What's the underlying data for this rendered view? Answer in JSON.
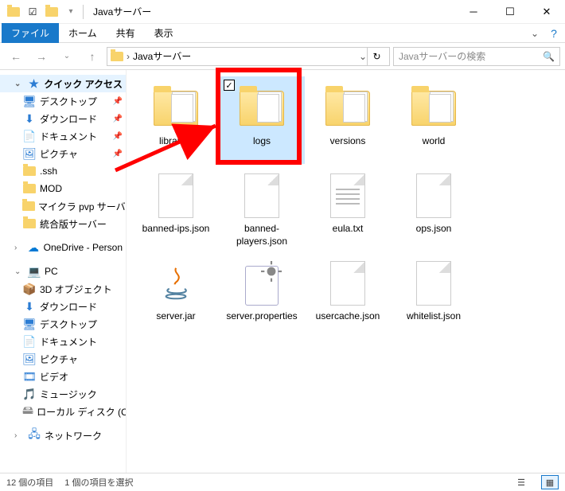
{
  "window": {
    "title": "Javaサーバー"
  },
  "ribbon": {
    "file": "ファイル",
    "home": "ホーム",
    "share": "共有",
    "view": "表示"
  },
  "address": {
    "crumb1": "Javaサーバー",
    "search_placeholder": "Javaサーバーの検索"
  },
  "nav": {
    "quick_access": "クイック アクセス",
    "desktop": "デスクトップ",
    "downloads": "ダウンロード",
    "documents": "ドキュメント",
    "pictures": "ピクチャ",
    "ssh": ".ssh",
    "mod": "MOD",
    "minecraft_pvp": "マイクラ pvp サーバー",
    "integrated": "統合版サーバー",
    "onedrive": "OneDrive - Person",
    "pc": "PC",
    "objects3d": "3D オブジェクト",
    "downloads2": "ダウンロード",
    "desktop2": "デスクトップ",
    "documents2": "ドキュメント",
    "pictures2": "ピクチャ",
    "videos": "ビデオ",
    "music": "ミュージック",
    "localdisk": "ローカル ディスク (C",
    "network": "ネットワーク"
  },
  "files": {
    "libraries": "libraries",
    "logs": "logs",
    "versions": "versions",
    "world": "world",
    "banned_ips": "banned-ips.json",
    "banned_players": "banned-players.json",
    "eula": "eula.txt",
    "ops": "ops.json",
    "server_jar": "server.jar",
    "server_props": "server.properties",
    "usercache": "usercache.json",
    "whitelist": "whitelist.json"
  },
  "status": {
    "item_count": "12 個の項目",
    "selected_count": "1 個の項目を選択"
  }
}
